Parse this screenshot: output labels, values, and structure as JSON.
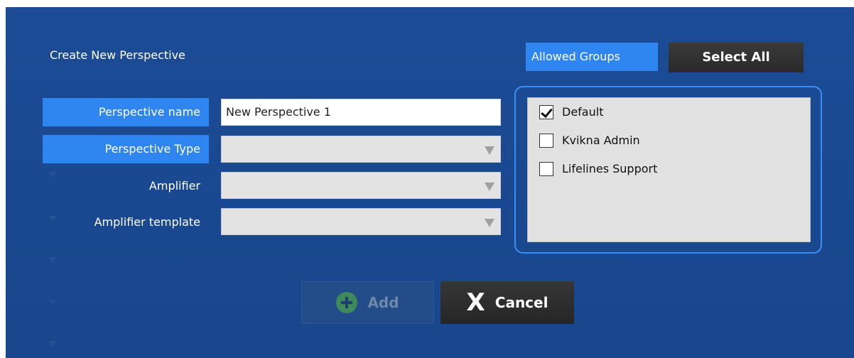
{
  "dialog": {
    "title": "Create New Perspective"
  },
  "form": {
    "fields": [
      {
        "label": "Perspective name",
        "value": "New Perspective 1"
      },
      {
        "label": "Perspective Type",
        "value": ""
      },
      {
        "label": "Amplifier",
        "value": ""
      },
      {
        "label": "Amplifier template",
        "value": ""
      }
    ]
  },
  "groups": {
    "label": "Allowed Groups",
    "select_all_label": "Select All",
    "items": [
      {
        "label": "Default",
        "checked": true
      },
      {
        "label": "Kvikna Admin",
        "checked": false
      },
      {
        "label": "Lifelines Support",
        "checked": false
      }
    ]
  },
  "buttons": {
    "add_label": "Add",
    "add_enabled": false,
    "cancel_label": "Cancel"
  },
  "colors": {
    "background": "#1c4c96",
    "accent": "#2f86f0",
    "dark_button": "#2a2a2a"
  },
  "icons": {
    "add": "plus-circle-icon",
    "cancel": "x-icon",
    "dropdown": "triangle-down-icon",
    "check": "checkmark-icon"
  }
}
